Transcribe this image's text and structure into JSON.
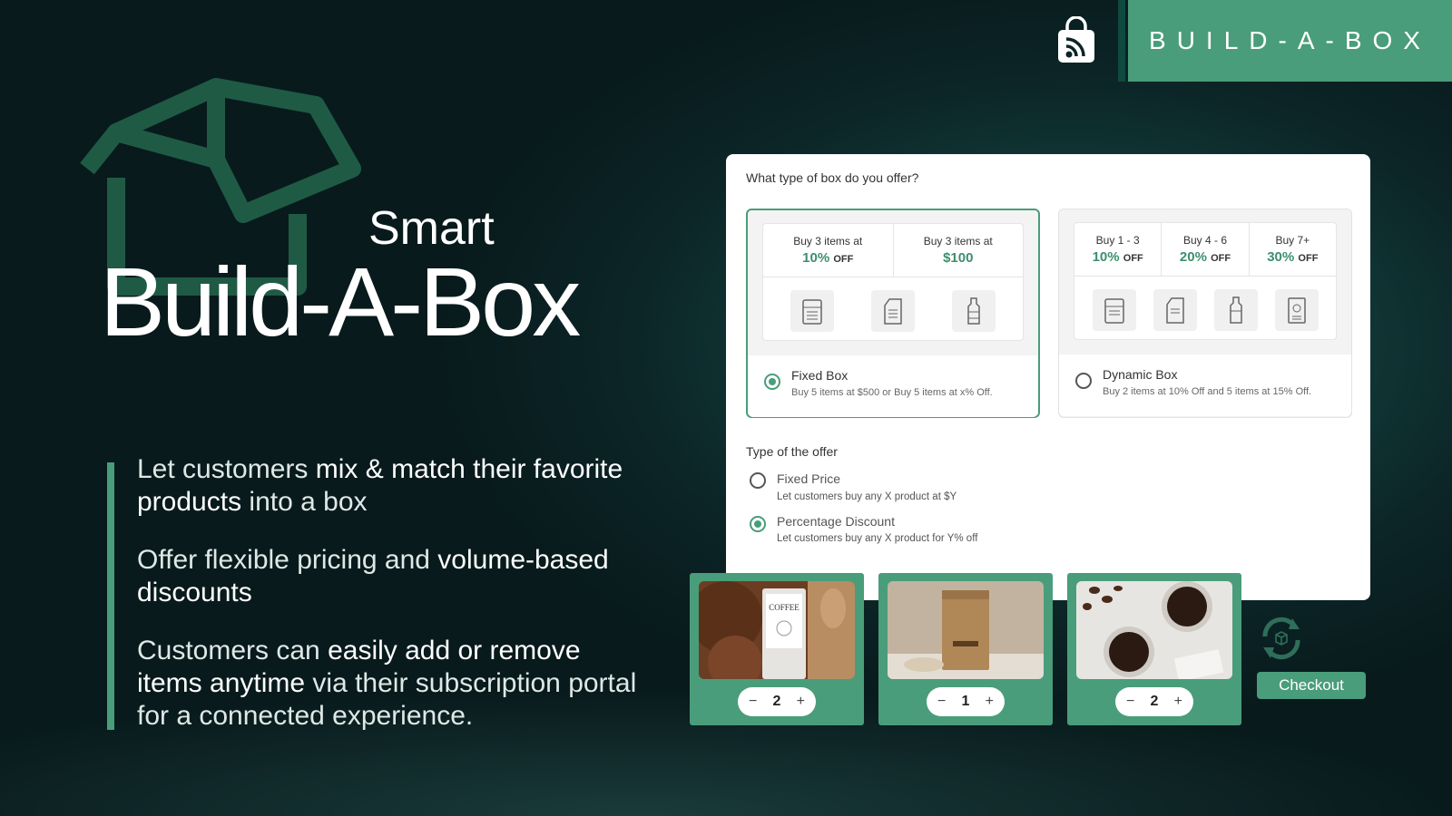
{
  "brand": {
    "name": "BUILD-A-BOX"
  },
  "hero": {
    "smart": "Smart",
    "title": "Build-A-Box"
  },
  "points": [
    {
      "pre": "Let customers ",
      "bold": "mix & match their favorite products",
      "post": " into a box"
    },
    {
      "pre": "Offer flexible pricing and ",
      "bold": "volume-based discounts",
      "post": ""
    },
    {
      "pre": "Customers can ",
      "bold": "easily add or remove items anytime",
      "post": " via their subscription portal for a connected experience."
    }
  ],
  "card": {
    "question": "What type of box do you offer?",
    "fixed": {
      "tiers": [
        {
          "label": "Buy 3 items at",
          "value": "10%",
          "suffix": "OFF"
        },
        {
          "label": "Buy 3 items at",
          "value": "$100",
          "suffix": ""
        }
      ],
      "title": "Fixed Box",
      "desc": "Buy 5 items at $500 or Buy 5 items at x% Off.",
      "selected": true
    },
    "dynamic": {
      "tiers": [
        {
          "label": "Buy 1 - 3",
          "value": "10%",
          "suffix": "OFF"
        },
        {
          "label": "Buy 4 - 6",
          "value": "20%",
          "suffix": "OFF"
        },
        {
          "label": "Buy 7+",
          "value": "30%",
          "suffix": "OFF"
        }
      ],
      "title": "Dynamic Box",
      "desc": "Buy 2 items at 10% Off and 5 items at 15% Off.",
      "selected": false
    },
    "offer_section": "Type of the offer",
    "offers": [
      {
        "label": "Fixed Price",
        "desc": "Let customers buy any X product at $Y",
        "selected": false
      },
      {
        "label": "Percentage Discount",
        "desc": "Let customers buy any X product for Y% off",
        "selected": true
      }
    ]
  },
  "products": [
    {
      "name": "coffee-grounds-pouch",
      "label": "COFFEE",
      "qty": "2"
    },
    {
      "name": "coffee-bag",
      "qty": "1"
    },
    {
      "name": "coffee-cups",
      "qty": "2"
    }
  ],
  "checkout": {
    "label": "Checkout"
  },
  "colors": {
    "accent": "#4a9d7a",
    "dark_bg": "#0c2527",
    "accent_text": "#3c8f6e"
  }
}
